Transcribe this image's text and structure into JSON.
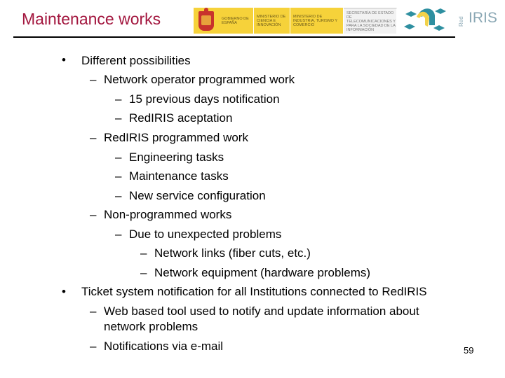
{
  "header": {
    "title": "Maintenance works",
    "title_color": "#a3173f",
    "government_logos": [
      {
        "name": "gobierno-de-espana",
        "text": "GOBIERNO DE ESPAÑA"
      },
      {
        "name": "ministerio-ciencia",
        "text": "MINISTERIO DE CIENCIA E INNOVACIÓN"
      },
      {
        "name": "ministerio-industria",
        "text": "MINISTERIO DE INDUSTRIA, TURISMO Y COMERCIO"
      },
      {
        "name": "secretaria-estado",
        "text": "SECRETARÍA DE ESTADO DE TELECOMUNICACIONES Y PARA LA SOCIEDAD DE LA INFORMACIÓN"
      }
    ],
    "rediris_logo": {
      "prefix": "Red",
      "text": "IRIS"
    }
  },
  "bullets": {
    "b1": {
      "text": "Different possibilities",
      "items": {
        "s1": {
          "text": "Network operator programmed work",
          "items": [
            "15 previous days notification",
            "RedIRIS aceptation"
          ]
        },
        "s2": {
          "text": "RedIRIS programmed work",
          "items": [
            "Engineering tasks",
            "Maintenance tasks",
            "New service configuration"
          ]
        },
        "s3": {
          "text": "Non-programmed works",
          "sub": {
            "text": "Due to unexpected problems",
            "items": [
              "Network links (fiber cuts, etc.)",
              "Network equipment (hardware problems)"
            ]
          }
        }
      }
    },
    "b2": {
      "text": "Ticket system notification for all Institutions connected to RedIRIS",
      "items": [
        "Web based tool used to notify and update information about network problems",
        "Notifications via e-mail"
      ],
      "item1_line1": "Web based tool used to notify and update information about",
      "item1_line2": "network problems"
    }
  },
  "markers": {
    "bullet": "•",
    "dash": "–"
  },
  "footer": {
    "page_number": "59"
  }
}
